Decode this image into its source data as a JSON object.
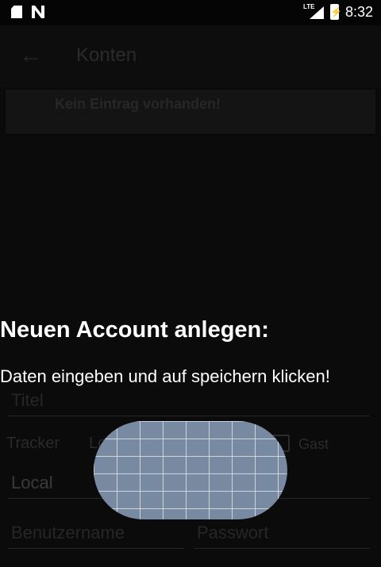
{
  "status_bar": {
    "time": "8:32",
    "network_type": "LTE",
    "icons": [
      "sd-card-icon",
      "n-icon",
      "signal-icon",
      "battery-charging-icon"
    ]
  },
  "app_bar": {
    "title": "Konten",
    "back_icon": "arrow-back-icon"
  },
  "list": {
    "empty_text": "Kein Eintrag vorhanden!"
  },
  "dialog": {
    "title": "Neuen Account anlegen:",
    "message": "Daten eingeben und auf speichern klicken!",
    "fields": {
      "title_placeholder": "Titel",
      "tracker_label": "Tracker",
      "tracker_value": "Local",
      "guest_label": "Gast",
      "host_value": "Local",
      "username_placeholder": "Benutzername",
      "password_placeholder": "Passwort"
    }
  },
  "colors": {
    "background": "#0b0b0b",
    "overlay_pill": "#7b8ca6"
  }
}
